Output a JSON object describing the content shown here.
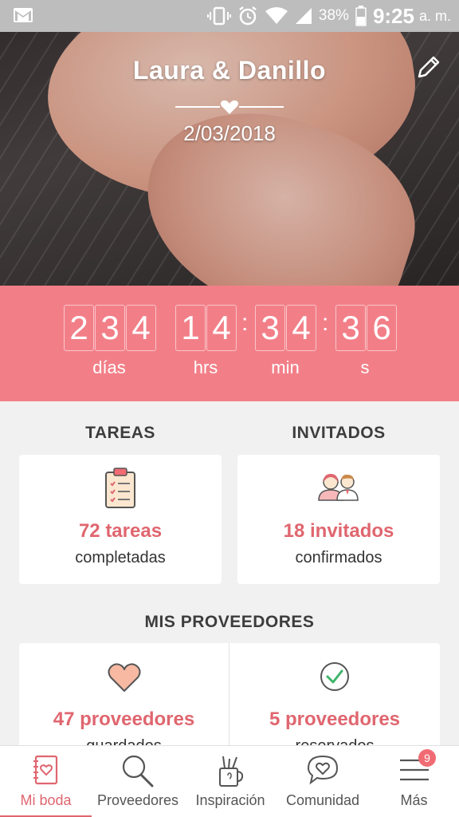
{
  "status_bar": {
    "battery_percent": "38%",
    "time": "9:25",
    "ampm": "a. m."
  },
  "hero": {
    "title": "Laura & Danillo",
    "date": "2/03/2018"
  },
  "countdown": {
    "days_digits": [
      "2",
      "3",
      "4"
    ],
    "hours_digits": [
      "1",
      "4"
    ],
    "minutes_digits": [
      "3",
      "4"
    ],
    "seconds_digits": [
      "3",
      "6"
    ],
    "labels": {
      "days": "días",
      "hours": "hrs",
      "minutes": "min",
      "seconds": "s"
    }
  },
  "tasks": {
    "heading": "TAREAS",
    "count": "72 tareas",
    "sub": "completadas"
  },
  "guests": {
    "heading": "INVITADOS",
    "count": "18 invitados",
    "sub": "confirmados"
  },
  "vendors": {
    "heading": "MIS PROVEEDORES",
    "saved_count": "47 proveedores",
    "saved_sub": "guardados",
    "booked_count": "5 proveedores",
    "booked_sub": "reservados"
  },
  "nav": {
    "items": [
      {
        "label": "Mi boda",
        "icon": "notebook-icon",
        "active": true
      },
      {
        "label": "Proveedores",
        "icon": "search-icon"
      },
      {
        "label": "Inspiración",
        "icon": "pencil-cup-icon"
      },
      {
        "label": "Comunidad",
        "icon": "chat-heart-icon"
      },
      {
        "label": "Más",
        "icon": "menu-icon"
      }
    ],
    "more_badge": "9"
  },
  "colors": {
    "accent": "#f27f88",
    "accent_text": "#e0666f",
    "status_bar": "#bdbdbd",
    "background": "#f1f1f1"
  }
}
